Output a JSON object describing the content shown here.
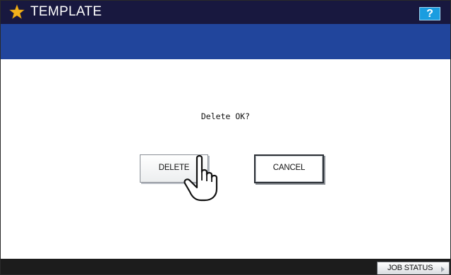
{
  "header": {
    "title": "TEMPLATE",
    "title_icon": "star-icon",
    "help_label": "?",
    "star_color": "#f2b21c",
    "bar_color": "#18183f",
    "help_color": "#1a9de0"
  },
  "subheader": {
    "color": "#21459c"
  },
  "dialog": {
    "message": "Delete OK?",
    "delete_label": "DELETE",
    "cancel_label": "CANCEL",
    "pointer_icon": "hand-pointer-icon"
  },
  "footer": {
    "job_status_label": "JOB STATUS",
    "job_status_icon": "chevron-right-icon"
  }
}
